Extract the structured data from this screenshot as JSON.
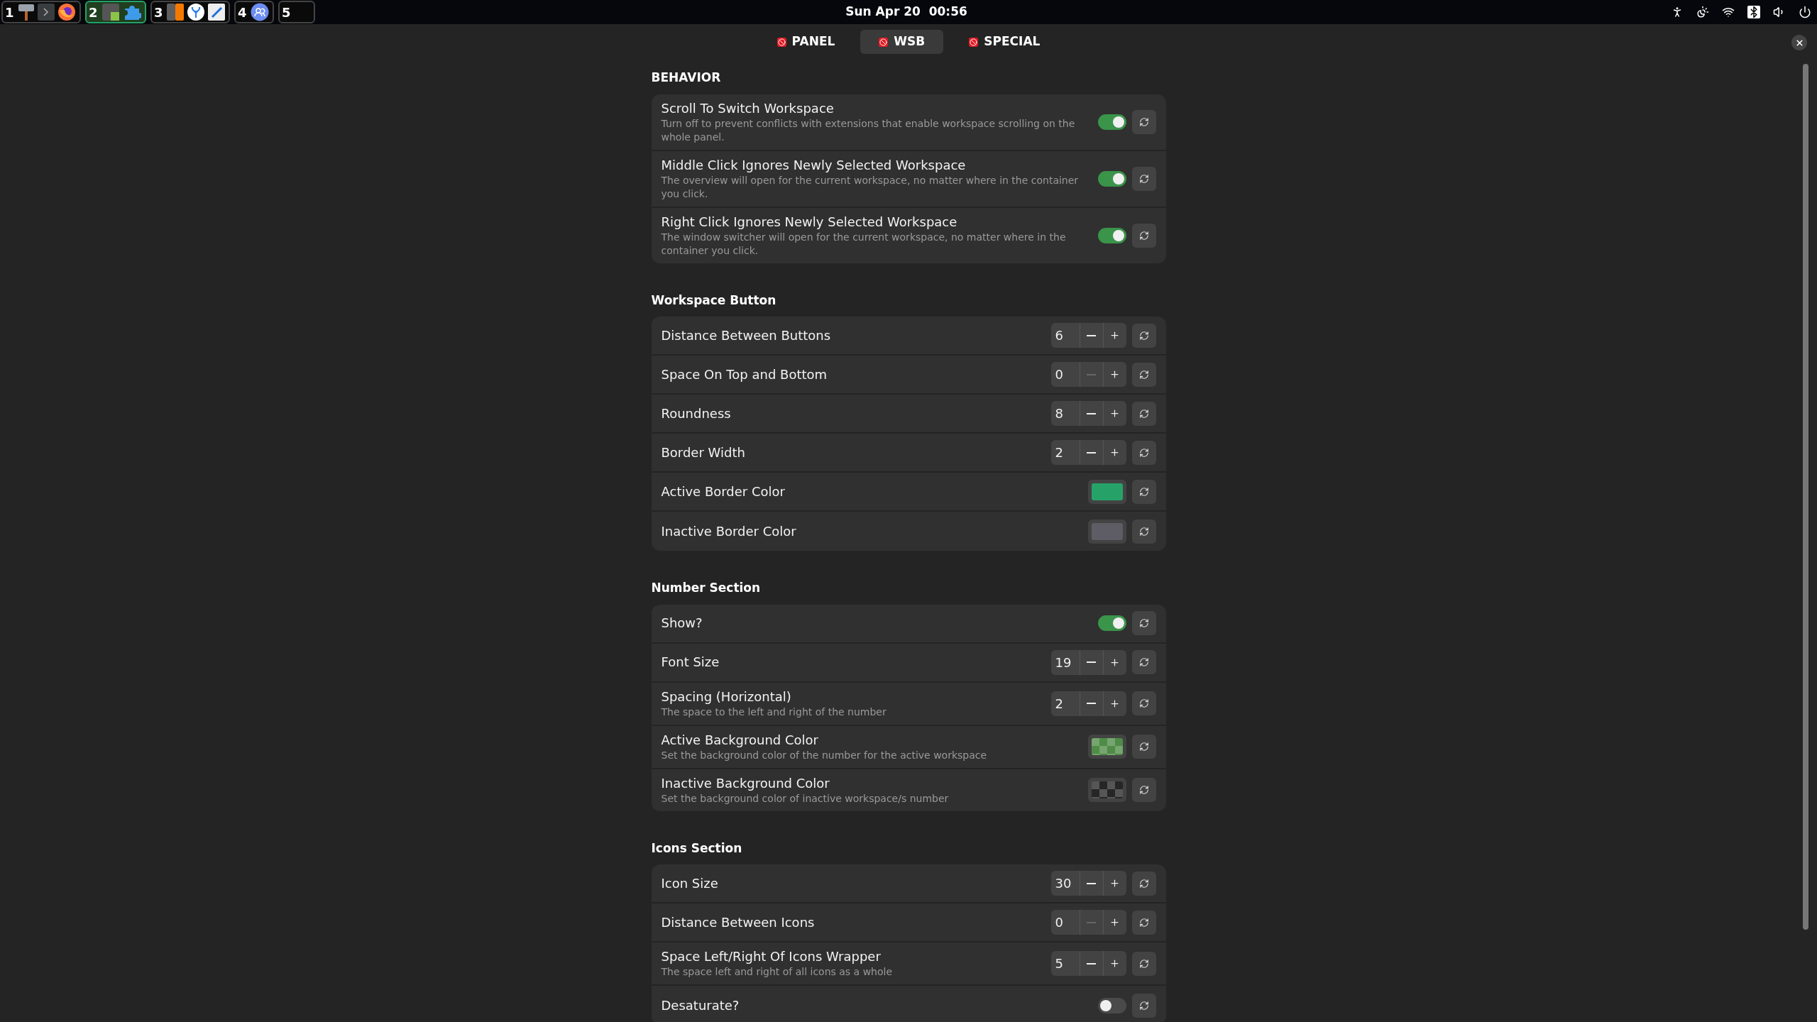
{
  "top_bar": {
    "workspaces": [
      {
        "number": "1",
        "selected": false,
        "apps": [
          {
            "kind": "tool"
          },
          {
            "kind": "terminal"
          },
          {
            "kind": "browser"
          }
        ]
      },
      {
        "number": "2",
        "selected": true,
        "apps": [
          {
            "kind": "puzzle-gray"
          },
          {
            "kind": "puzzle-blue"
          }
        ]
      },
      {
        "number": "3",
        "selected": false,
        "apps": [
          {
            "kind": "calculator"
          },
          {
            "kind": "code"
          },
          {
            "kind": "editor"
          }
        ]
      },
      {
        "number": "4",
        "selected": false,
        "apps": [
          {
            "kind": "contacts"
          }
        ]
      },
      {
        "number": "5",
        "selected": false
      }
    ],
    "clock": "Sun Apr 20  00:56"
  },
  "tabs": [
    {
      "label": "PANEL",
      "selected": false
    },
    {
      "label": "WSB",
      "selected": true
    },
    {
      "label": "SPECIAL",
      "selected": false
    }
  ],
  "sections": [
    {
      "title": "BEHAVIOR",
      "rows": [
        {
          "kind": "toggle",
          "title": "Scroll To Switch Workspace",
          "description": "Turn off to prevent conflicts with extensions that enable workspace scrolling on the whole panel.",
          "on": true
        },
        {
          "kind": "toggle",
          "title": "Middle Click Ignores Newly Selected Workspace",
          "description": "The overview will open for the current workspace, no matter where in the container you click.",
          "on": true
        },
        {
          "kind": "toggle",
          "title": "Right Click Ignores Newly Selected Workspace",
          "description": "The window switcher will open for the current workspace, no matter where in the container you click.",
          "on": true
        }
      ]
    },
    {
      "title": "Workspace Button",
      "rows": [
        {
          "kind": "spin",
          "title": "Distance Between Buttons",
          "value": "6",
          "minus_disabled": false
        },
        {
          "kind": "spin",
          "title": "Space On Top and Bottom",
          "value": "0",
          "minus_disabled": true
        },
        {
          "kind": "spin",
          "title": "Roundness",
          "value": "8",
          "minus_disabled": false
        },
        {
          "kind": "spin",
          "title": "Border Width",
          "value": "2",
          "minus_disabled": false
        },
        {
          "kind": "color",
          "title": "Active Border Color",
          "color": "#26a269",
          "transparent": false
        },
        {
          "kind": "color",
          "title": "Inactive Border Color",
          "color": "#5e5c64",
          "transparent": false
        }
      ]
    },
    {
      "title": "Number Section",
      "rows": [
        {
          "kind": "toggle",
          "title": "Show?",
          "on": true
        },
        {
          "kind": "spin",
          "title": "Font Size",
          "value": "19",
          "minus_disabled": false
        },
        {
          "kind": "spin",
          "title": "Spacing (Horizontal)",
          "description": "The space to the left and right of the number",
          "value": "2",
          "minus_disabled": false
        },
        {
          "kind": "color",
          "title": "Active Background Color",
          "description": "Set the background color of the number for the active workspace",
          "color": "#4f8c47",
          "transparent": true
        },
        {
          "kind": "color",
          "title": "Inactive Background Color",
          "description": "Set the background color of inactive workspace/s number",
          "color": "#262626",
          "transparent": true
        }
      ]
    },
    {
      "title": "Icons Section",
      "rows": [
        {
          "kind": "spin",
          "title": "Icon Size",
          "value": "30",
          "minus_disabled": false
        },
        {
          "kind": "spin",
          "title": "Distance Between Icons",
          "value": "0",
          "minus_disabled": true
        },
        {
          "kind": "spin",
          "title": "Space Left/Right Of Icons Wrapper",
          "description": "The space left and right of all icons as a whole",
          "value": "5",
          "minus_disabled": false
        },
        {
          "kind": "toggle",
          "title": "Desaturate?",
          "on": false
        }
      ]
    }
  ]
}
